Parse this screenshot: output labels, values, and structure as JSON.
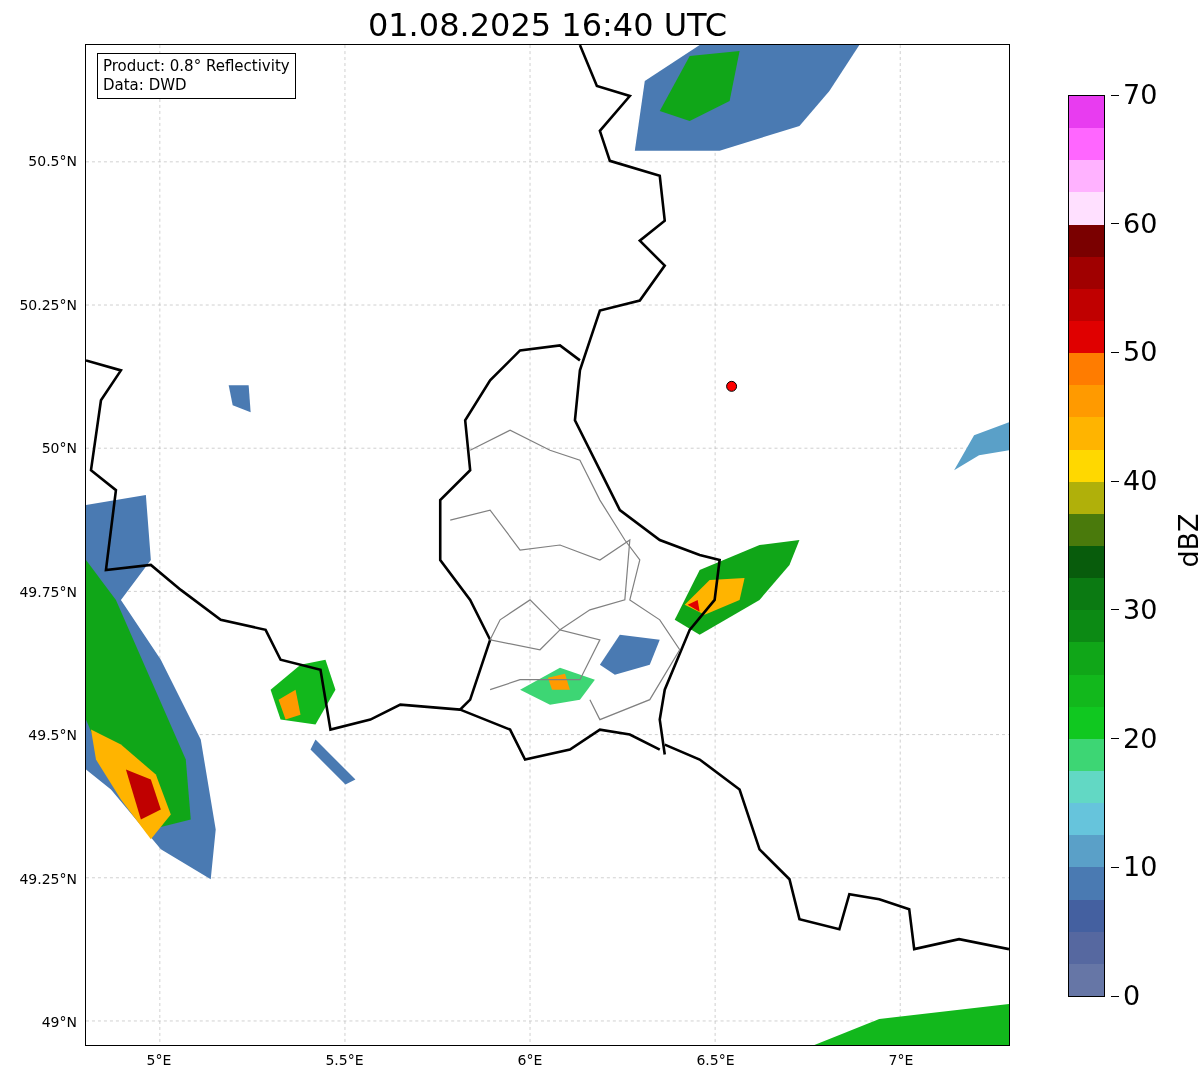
{
  "title": "01.08.2025 16:40 UTC",
  "map": {
    "info_lines": [
      "Product: 0.8° Reflectivity",
      "Data: DWD"
    ],
    "y_ticks": [
      "50.5°N",
      "50.25°N",
      "50°N",
      "49.75°N",
      "49.5°N",
      "49.25°N",
      "49°N"
    ],
    "x_ticks": [
      "5°E",
      "5.5°E",
      "6°E",
      "6.5°E",
      "7°E"
    ]
  },
  "colorbar": {
    "label": "dBZ",
    "ticks": [
      "70",
      "60",
      "50",
      "40",
      "30",
      "20",
      "10",
      "0"
    ],
    "bins": [
      {
        "color": "#e83cf0"
      },
      {
        "color": "#ff66ff"
      },
      {
        "color": "#ffb2ff"
      },
      {
        "color": "#ffe0ff"
      },
      {
        "color": "#7a0000"
      },
      {
        "color": "#a00000"
      },
      {
        "color": "#c00000"
      },
      {
        "color": "#e00000"
      },
      {
        "color": "#ff7c00"
      },
      {
        "color": "#ff9a00"
      },
      {
        "color": "#ffb400"
      },
      {
        "color": "#ffd800"
      },
      {
        "color": "#b0b00a"
      },
      {
        "color": "#4a7a0c"
      },
      {
        "color": "#085c0c"
      },
      {
        "color": "#0b7a12"
      },
      {
        "color": "#0c8a14"
      },
      {
        "color": "#10a618"
      },
      {
        "color": "#12b81c"
      },
      {
        "color": "#10c820"
      },
      {
        "color": "#3dd674"
      },
      {
        "color": "#62d8c4"
      },
      {
        "color": "#66c4dc"
      },
      {
        "color": "#5aa0c8"
      },
      {
        "color": "#4a7ab2"
      },
      {
        "color": "#4460a0"
      },
      {
        "color": "#5668a0"
      },
      {
        "color": "#6676a6"
      }
    ]
  }
}
